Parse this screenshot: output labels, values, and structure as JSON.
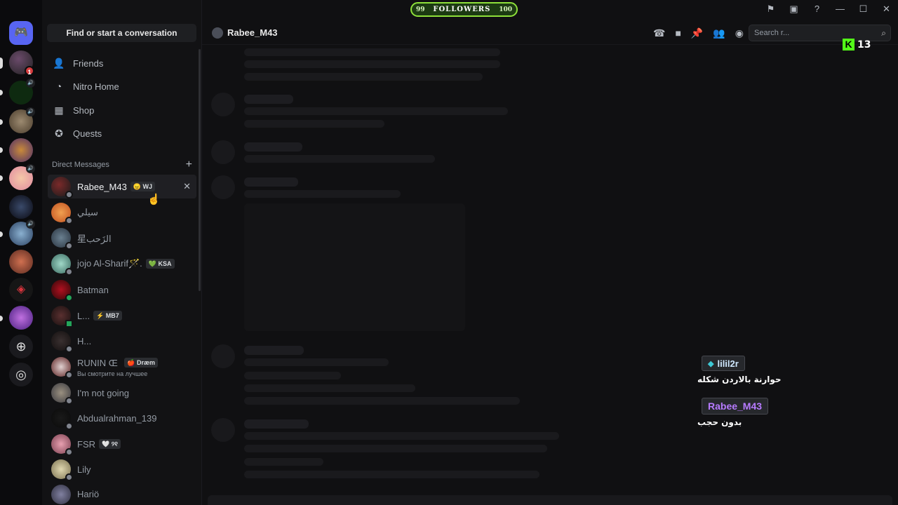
{
  "overlay": {
    "followers": {
      "left": "99",
      "label": "FOLLOWERS",
      "right": "100"
    },
    "kick": {
      "logo": "K",
      "count": "13"
    },
    "chat": [
      {
        "user": "lilil2r",
        "message": "حوارنة بالاردن شكله"
      },
      {
        "user": "Rabee_M43",
        "message": "بدون حجب"
      }
    ]
  },
  "rail": {
    "home_icon": "discord-icon",
    "badge_count": "1"
  },
  "sidebar": {
    "search_label": "Find or start a conversation",
    "nav": [
      {
        "label": "Friends",
        "icon": "friends-icon"
      },
      {
        "label": "Nitro Home",
        "icon": "nitro-icon"
      },
      {
        "label": "Shop",
        "icon": "shop-icon"
      },
      {
        "label": "Quests",
        "icon": "quests-icon"
      }
    ],
    "dm_header": "Direct Messages",
    "dms": [
      {
        "name": "Rabee_M43",
        "tag": "😠 WJ",
        "sub": ""
      },
      {
        "name": "سيلي",
        "tag": "",
        "sub": ""
      },
      {
        "name": "星الزَحب",
        "tag": "",
        "sub": ""
      },
      {
        "name": "jojo Al-Sharif🪄.",
        "tag": "💚 KSA",
        "sub": ""
      },
      {
        "name": "Batman",
        "tag": "",
        "sub": ""
      },
      {
        "name": "L...",
        "tag": "⚡ MB7",
        "sub": ""
      },
      {
        "name": "H...",
        "tag": "",
        "sub": ""
      },
      {
        "name": "RUNIN Œ",
        "tag": "🍎 Dræm",
        "sub": "Вы смотрите на лучшее"
      },
      {
        "name": "I'm not going",
        "tag": "",
        "sub": ""
      },
      {
        "name": "Abdualrahman_139",
        "tag": "",
        "sub": ""
      },
      {
        "name": "FSR",
        "tag": "🤍 ୨୧",
        "sub": ""
      },
      {
        "name": "Lily",
        "tag": "",
        "sub": ""
      },
      {
        "name": "Hariö",
        "tag": "",
        "sub": ""
      }
    ]
  },
  "main": {
    "channel_name": "Rabee_M43",
    "search_placeholder": "Search r..."
  }
}
